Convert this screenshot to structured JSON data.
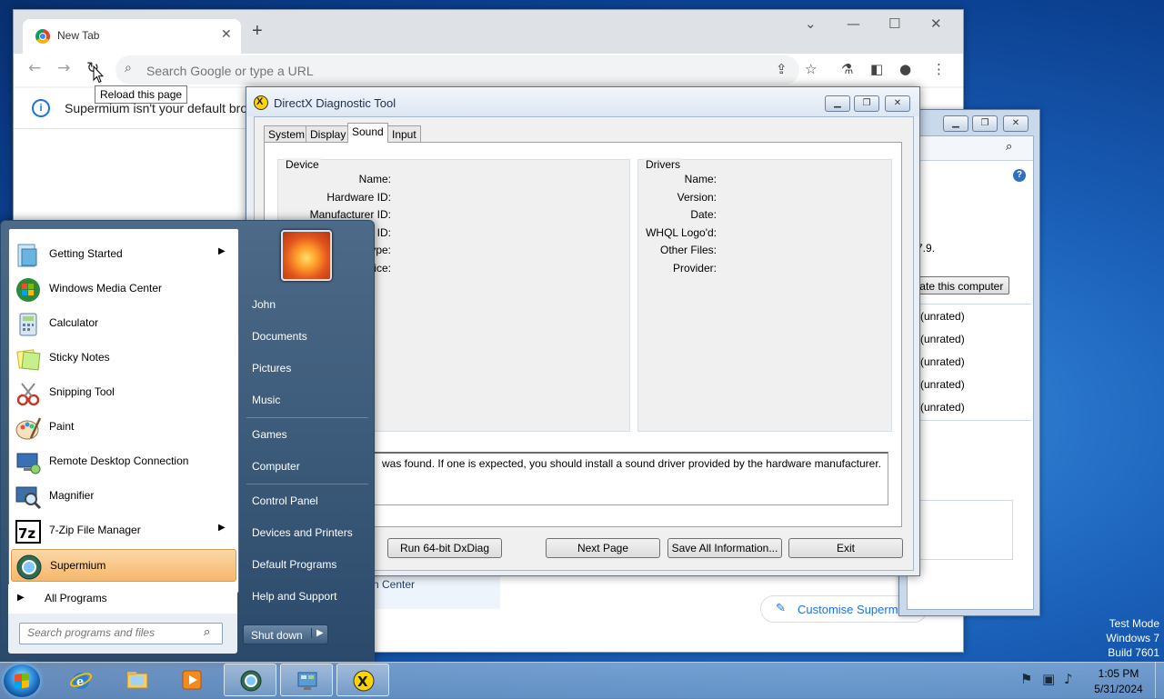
{
  "browser": {
    "tab_title": "New Tab",
    "address_placeholder": "Search Google or type a URL",
    "tooltip": "Reload this page",
    "infobar_message": "Supermium isn't your default brow",
    "customise_label": "Customise Supermium"
  },
  "perf_window": {
    "version_text": "p 7.9.",
    "rate_button": "Rate this computer",
    "scores": [
      "(unrated)",
      "(unrated)",
      "(unrated)",
      "(unrated)",
      "(unrated)"
    ],
    "partial_link": "n Center"
  },
  "dxdiag": {
    "title": "DirectX Diagnostic Tool",
    "tabs": [
      "System",
      "Display",
      "Sound",
      "Input"
    ],
    "active_tab": "Sound",
    "device_group": "Device",
    "device_labels": [
      "Name:",
      "Hardware ID:",
      "Manufacturer ID:",
      "ID:",
      "ype:",
      "ice:"
    ],
    "drivers_group": "Drivers",
    "driver_labels": [
      "Name:",
      "Version:",
      "Date:",
      "WHQL Logo'd:",
      "Other Files:",
      "Provider:"
    ],
    "notes_text": "was found.  If one is expected, you should install a sound driver provided by the hardware manufacturer.",
    "buttons": {
      "run64": "Run 64-bit DxDiag",
      "next": "Next Page",
      "save": "Save All Information...",
      "exit": "Exit"
    }
  },
  "start_menu": {
    "programs": [
      {
        "name": "Getting Started",
        "submenu": true
      },
      {
        "name": "Windows Media Center",
        "submenu": false
      },
      {
        "name": "Calculator",
        "submenu": false
      },
      {
        "name": "Sticky Notes",
        "submenu": false
      },
      {
        "name": "Snipping Tool",
        "submenu": false
      },
      {
        "name": "Paint",
        "submenu": false
      },
      {
        "name": "Remote Desktop Connection",
        "submenu": false
      },
      {
        "name": "Magnifier",
        "submenu": false
      },
      {
        "name": "7-Zip File Manager",
        "submenu": true
      },
      {
        "name": "Supermium",
        "submenu": false
      }
    ],
    "all_programs": "All Programs",
    "search_placeholder": "Search programs and files",
    "right_links": [
      "John",
      "Documents",
      "Pictures",
      "Music",
      "Games",
      "Computer",
      "Control Panel",
      "Devices and Printers",
      "Default Programs",
      "Help and Support"
    ],
    "shutdown": "Shut down",
    "icon_names": [
      "getting-started-icon",
      "media-center-icon",
      "calculator-icon",
      "sticky-notes-icon",
      "snipping-tool-icon",
      "paint-icon",
      "remote-desktop-icon",
      "magnifier-icon",
      "seven-zip-icon",
      "supermium-icon"
    ]
  },
  "taskbar": {
    "time": "1:05 PM",
    "date": "5/31/2024"
  },
  "desktop": {
    "watermark": [
      "Test Mode",
      "Windows 7",
      "Build 7601"
    ]
  }
}
